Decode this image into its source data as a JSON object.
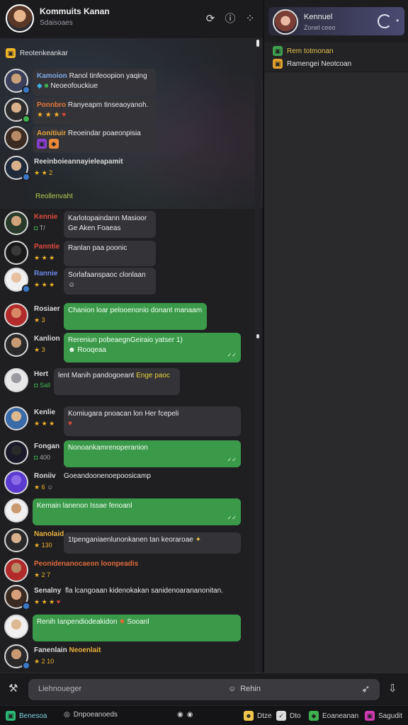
{
  "header": {
    "title": "Kommuits Kanan",
    "subtitle": "Sdaisoaes"
  },
  "pinned": {
    "label": "Reotenkeankar"
  },
  "divider_label": "Reollenvaht",
  "messages": [
    {
      "user": "Kamoion",
      "user_color": "#7fa8e6",
      "meta": "",
      "text": "Ranol tinfeoopion yaqing",
      "text2": "Neoeofouckiue",
      "bubble": "dark"
    },
    {
      "user": "Ponnbro",
      "user_color": "#e3763a",
      "meta": "★ ★ ★",
      "text": "Ranyeapm tinseaoyanoh.",
      "text2": "",
      "bubble": "dark"
    },
    {
      "user": "Aonitiuir",
      "user_color": "#e8a43b",
      "meta": "",
      "text": "Reoeindar poaeonpisia",
      "text2": "",
      "bubble": "dark"
    },
    {
      "user": "Reeinboieannayieleapamit",
      "user_color": "#dcdcdc",
      "meta": "★ ★ 2",
      "text": "",
      "text2": "",
      "bubble": "none"
    },
    {
      "user": "Kennie",
      "user_color": "#e04a3b",
      "meta": "T/",
      "text": "Karlotopaindann Masioor",
      "text2": "Ge Aken Foaeas",
      "bubble": "dark"
    },
    {
      "user": "Panntie",
      "user_color": "#e04a3b",
      "meta": "★ ★ ★",
      "text": "Ranlan paa poonic",
      "text2": "",
      "bubble": "dark"
    },
    {
      "user": "Rannie",
      "user_color": "#6c8ae8",
      "meta": "★ ★ ★",
      "text": "Sorlafaanspaoc clonlaan",
      "text2": "",
      "bubble": "dark"
    },
    {
      "user": "Rosiaer",
      "user_color": "#dcdcdc",
      "meta": "★ 3",
      "text": "Chanion loar pelooenonio donant manaam",
      "text2": "",
      "bubble": "green"
    },
    {
      "user": "Kanlion",
      "user_color": "#dcdcdc",
      "meta": "★ 3",
      "text": "Rereniun pobeaegnGeiraio yatser 1)",
      "text2": "Rooqeaa",
      "bubble": "green"
    },
    {
      "user": "Hert",
      "user_color": "#dcdcdc",
      "meta": "Sall",
      "text": "lent Manih pandogoeant",
      "text2": "Enge paoc",
      "bubble": "dark"
    },
    {
      "user": "Kenlie",
      "user_color": "#dcdcdc",
      "meta": "★ ★ ★",
      "text": "Komiugara pnoacan lon Her fcepeli",
      "text2": "",
      "bubble": "dark"
    },
    {
      "user": "Fongan",
      "user_color": "#dcdcdc",
      "meta": "400",
      "text": "Nonoankamrenoperanion",
      "text2": "",
      "bubble": "green"
    },
    {
      "user": "Roniiv",
      "user_color": "#dcdcdc",
      "meta": "★ 6",
      "text": "Goeandoonenoepoosicamp",
      "text2": "",
      "bubble": "none"
    },
    {
      "user": "Kemain",
      "user_color": "#dcdcdc",
      "meta": "",
      "text": "Kemain lanenon Issae fenoanl",
      "text2": "",
      "bubble": "green"
    },
    {
      "user": "Nanolaid",
      "user_color": "#e9b23b",
      "meta": "★ 130",
      "text": "1tpenganiaenlunonkanen tan keoraroae",
      "text2": "",
      "bubble": "dark"
    },
    {
      "user": "Peonidenanocaeon loonpeadis",
      "user_color": "#e06a3a",
      "meta": "★ 2 7",
      "text": "",
      "text2": "",
      "bubble": "none"
    },
    {
      "user": "Senalny",
      "user_color": "#dcdcdc",
      "meta": "★ ★ ★",
      "text": "fla lcangoaan kidenokakan sanidenoarananonitan.",
      "text2": "",
      "bubble": "none"
    },
    {
      "user": "Renih",
      "user_color": "#dcdcdc",
      "meta": "",
      "text": "Ianpendiodeakidon",
      "text2": "Sooanl",
      "bubble": "green"
    },
    {
      "user": "Fanenlain",
      "user_color": "#dcdcdc",
      "meta": "★ 2 10",
      "text": "Neoenlait",
      "text2": "",
      "bubble": "none"
    }
  ],
  "right": {
    "name": "Kennuel",
    "sub": "Zonel ceeo",
    "links": [
      {
        "label": "Rem totmonan",
        "color": "#3fa14f"
      },
      {
        "label": "Ramengei Neotcoan",
        "color": "#e0a22d"
      }
    ]
  },
  "compose": {
    "placeholder": "Liehnoueger",
    "mid_label": "Rehin"
  },
  "footer": {
    "items": [
      {
        "label": "Benesoa",
        "color": "#2bb673"
      },
      {
        "label": "Dnpoeanoeds",
        "color": "#888"
      },
      {
        "label": "Dtze",
        "color": "#f0c64a"
      },
      {
        "label": "Dto",
        "color": "#dcdcdc"
      },
      {
        "label": "Eoaneanan",
        "color": "#3fb14f"
      },
      {
        "label": "Sagudit",
        "color": "#d23ab3"
      }
    ]
  }
}
